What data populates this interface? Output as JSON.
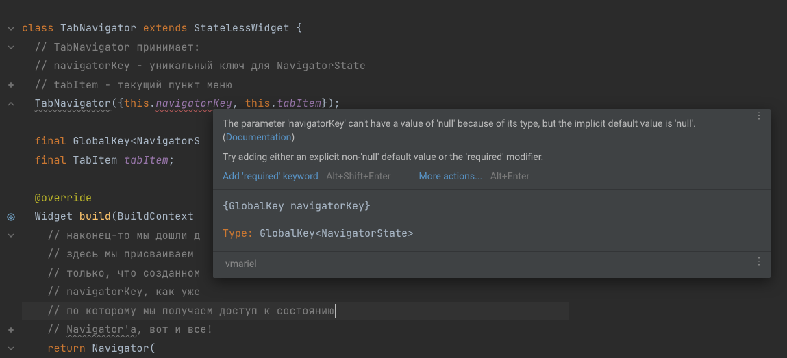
{
  "code": {
    "l1": {
      "kw1": "class ",
      "cls": "TabNavigator ",
      "kw2": "extends ",
      "sup": "StatelessWidget ",
      "brace": "{"
    },
    "l2": "  // TabNavigator принимает:",
    "l3": "  // navigatorKey - уникальный ключ для NavigatorState",
    "l4": "  // tabItem - текущий пункт меню",
    "l5": {
      "ctor": "TabNavigator",
      "brace": "({",
      "this1": "this",
      "dot1": ".",
      "p1": "navigatorKey",
      "comma": ", ",
      "this2": "this",
      "dot2": ".",
      "p2": "tabItem",
      "end": "});"
    },
    "l6": "",
    "l7": {
      "kw": "final ",
      "type": "GlobalKey<NavigatorS"
    },
    "l8": {
      "kw": "final ",
      "type": "TabItem ",
      "name": "tabItem",
      "semi": ";"
    },
    "l9": "",
    "l10": {
      "at": "@",
      "anno": "override"
    },
    "l11": {
      "ret": "Widget ",
      "fn": "build",
      "paren": "(BuildContext "
    },
    "l12": "    // наконец-то мы дошли д",
    "l13": "    // здесь мы присваиваем ",
    "l14": "    // только, что созданном",
    "l15": "    // navigatorKey, как уже",
    "l16": "    // по которому мы получаем доступ к состоянию",
    "l17_a": "    // ",
    "l17_b": "Navigator'a",
    "l17_c": ", вот и все!",
    "l18": {
      "kw": "return ",
      "cls": "Navigator",
      "paren": "("
    }
  },
  "popup": {
    "msg_a": "The parameter 'navigatorKey' can't have a value of 'null' because of its type, but the implicit default value is 'null'. (",
    "doc": "Documentation",
    "msg_b": ")",
    "hint": "Try adding either an explicit non-'null' default value or the 'required' modifier.",
    "action1": "Add 'required' keyword",
    "kbd1": "Alt+Shift+Enter",
    "action2": "More actions...",
    "kbd2": "Alt+Enter",
    "sig": "{GlobalKey navigatorKey}",
    "type_label": "Type: ",
    "type_value": "GlobalKey<NavigatorState>",
    "author": "vmariel"
  }
}
